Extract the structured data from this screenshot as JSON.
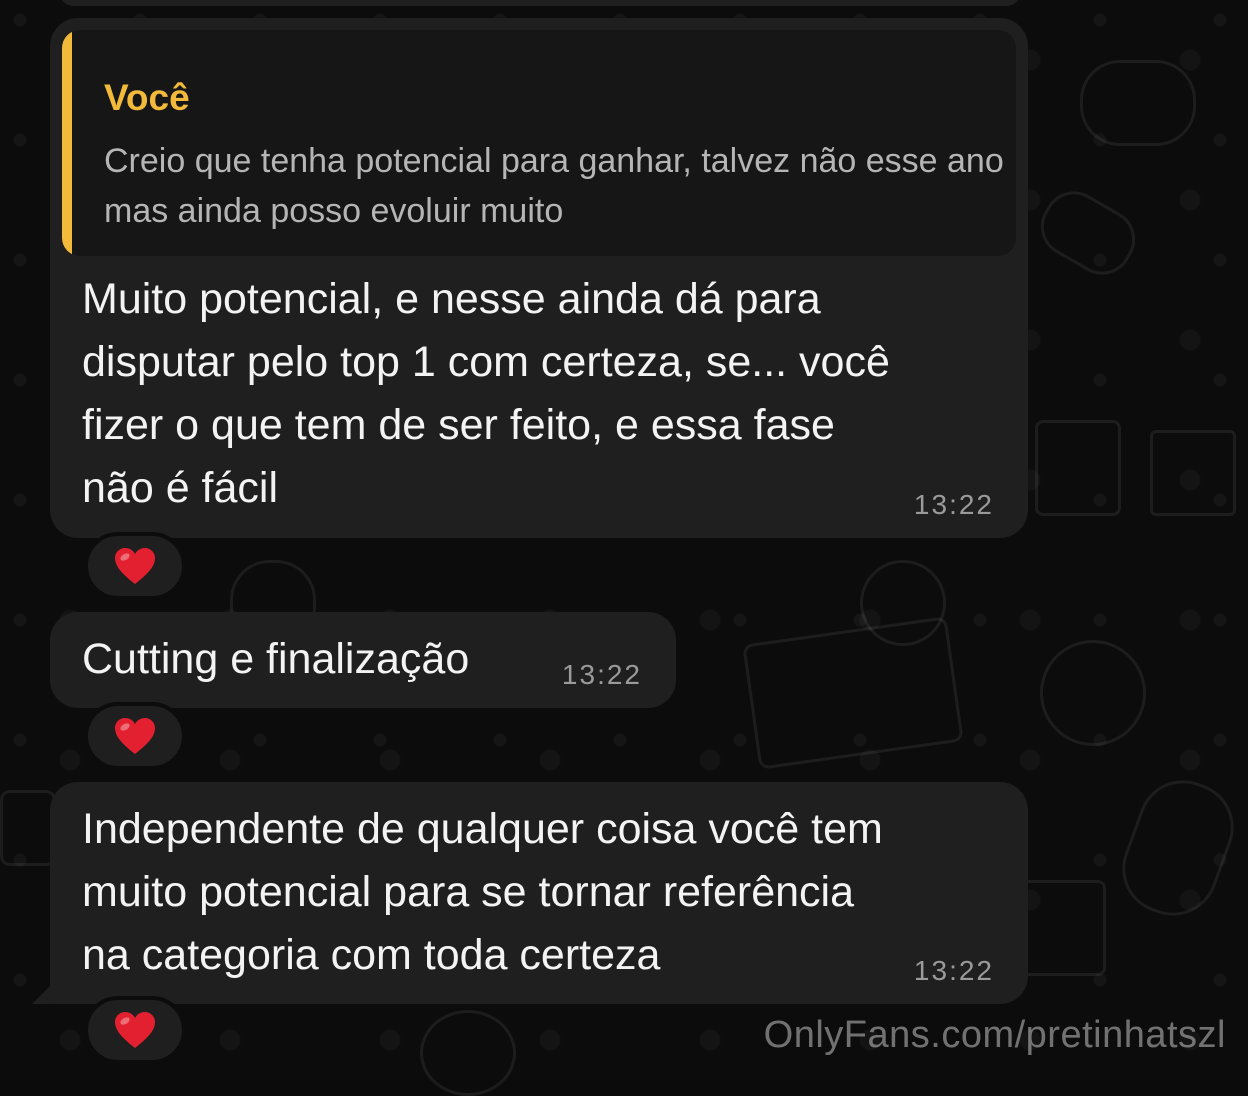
{
  "messages": [
    {
      "quote": {
        "author": "Você",
        "text": "Creio que tenha potencial para ganhar, talvez não esse ano mas ainda posso evoluir muito"
      },
      "lines": [
        "Muito potencial, e nesse ainda dá para",
        "disputar pelo top 1 com certeza, se... você",
        "fizer o que tem de ser feito, e essa fase",
        "não é fácil"
      ],
      "time": "13:22",
      "reaction": "❤️"
    },
    {
      "lines": [
        "Cutting e finalização"
      ],
      "time": "13:22",
      "reaction": "❤️"
    },
    {
      "lines": [
        "Independente de qualquer coisa você tem",
        "muito potencial para se tornar referência",
        "na categoria com toda certeza"
      ],
      "time": "13:22",
      "reaction": "❤️"
    }
  ],
  "watermark": "OnlyFans.com/pretinhatszl",
  "colors": {
    "quote_accent": "#f3b93a",
    "bubble_background": "#1f1f1f",
    "heart": "#e3202f"
  }
}
